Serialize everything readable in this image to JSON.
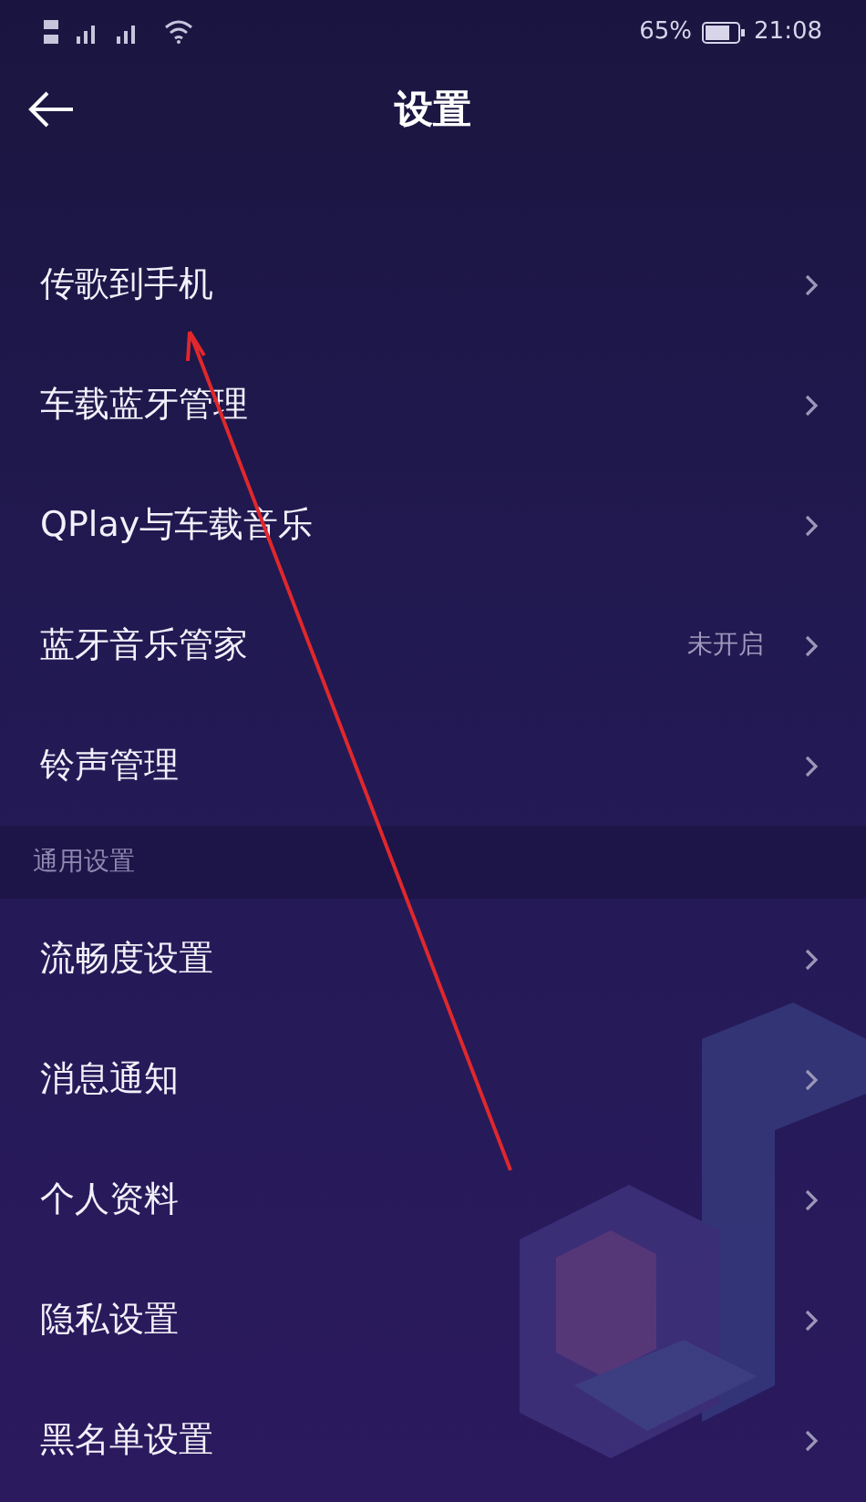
{
  "status_bar": {
    "battery": "65%",
    "time": "21:08"
  },
  "header": {
    "title": "设置"
  },
  "sections": [
    {
      "items": [
        {
          "label": "传歌到手机"
        },
        {
          "label": "车载蓝牙管理"
        },
        {
          "label": "QPlay与车载音乐"
        },
        {
          "label": "蓝牙音乐管家",
          "value": "未开启"
        },
        {
          "label": "铃声管理"
        }
      ]
    },
    {
      "title": "通用设置",
      "items": [
        {
          "label": "流畅度设置"
        },
        {
          "label": "消息通知"
        },
        {
          "label": "个人资料"
        },
        {
          "label": "隐私设置"
        },
        {
          "label": "黑名单设置"
        }
      ]
    }
  ]
}
